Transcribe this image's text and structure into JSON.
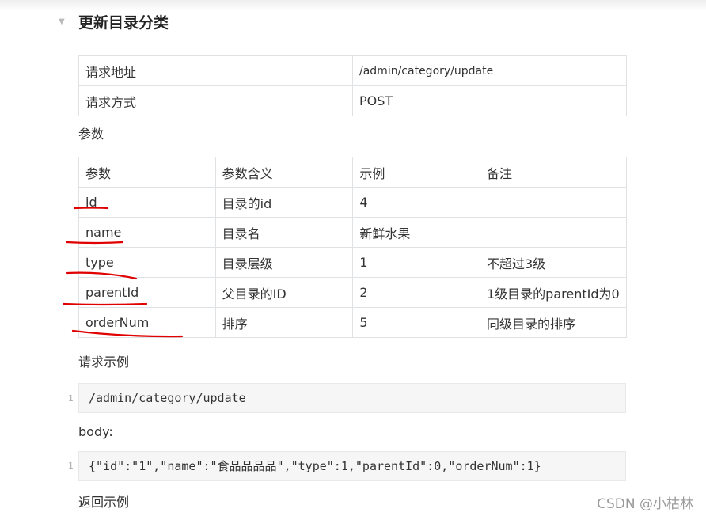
{
  "heading": "更新目录分类",
  "request_table": [
    {
      "label": "请求地址",
      "value": "/admin/category/update"
    },
    {
      "label": "请求方式",
      "value": "POST"
    }
  ],
  "params_label": "参数",
  "params_table": {
    "headers": [
      "参数",
      "参数含义",
      "示例",
      "备注"
    ],
    "rows": [
      [
        "id",
        "目录的id",
        "4",
        ""
      ],
      [
        "name",
        "目录名",
        "新鲜水果",
        ""
      ],
      [
        "type",
        "目录层级",
        "1",
        "不超过3级"
      ],
      [
        "parentId",
        "父目录的ID",
        "2",
        "1级目录的parentId为0"
      ],
      [
        "orderNum",
        "排序",
        "5",
        "同级目录的排序"
      ]
    ]
  },
  "request_example_label": "请求示例",
  "request_example_code": "/admin/category/update",
  "body_label": "body:",
  "body_code": "{\"id\":\"1\",\"name\":\"食品品品品\",\"type\":1,\"parentId\":0,\"orderNum\":1}",
  "line_number": "1",
  "response_example_label": "返回示例",
  "watermark": "CSDN @小枯林",
  "annotation_color": "#e00000"
}
